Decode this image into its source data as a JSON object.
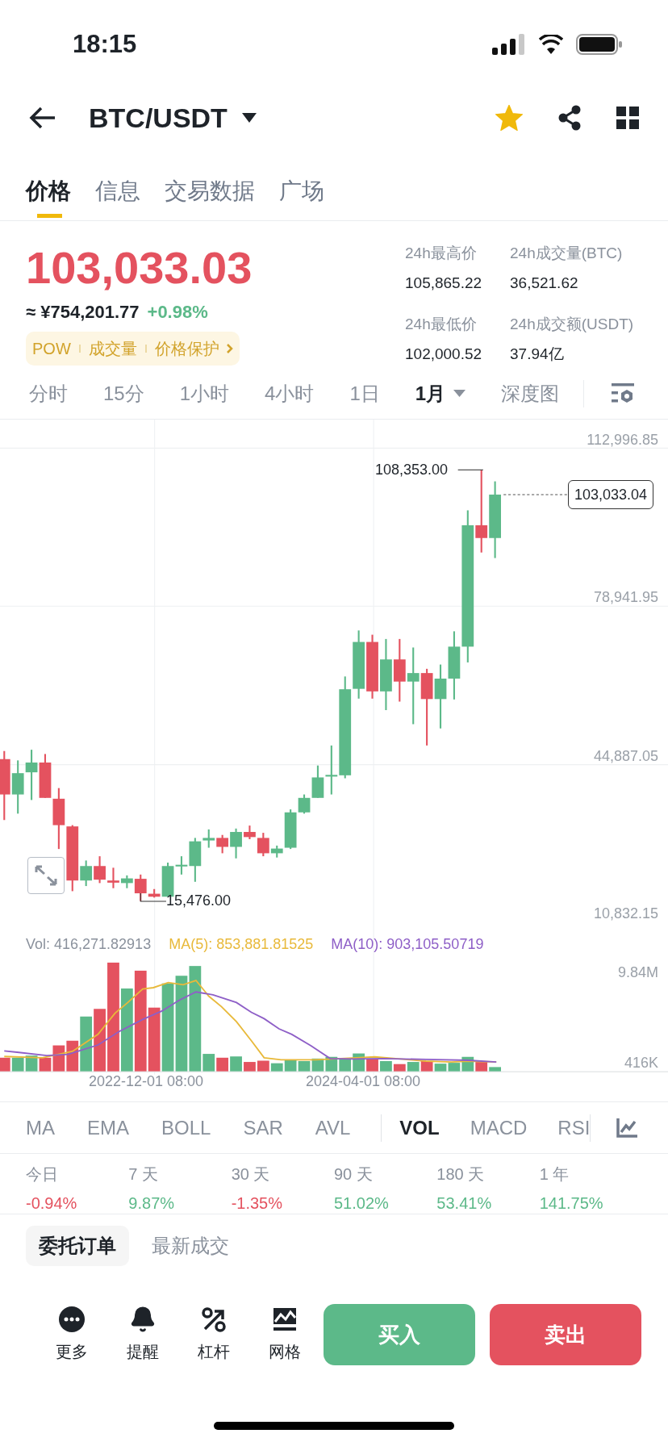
{
  "status_bar": {
    "time": "18:15"
  },
  "header": {
    "pair": "BTC/USDT",
    "favorite": true
  },
  "tabs": [
    {
      "label": "价格",
      "selected": true
    },
    {
      "label": "信息",
      "selected": false
    },
    {
      "label": "交易数据",
      "selected": false
    },
    {
      "label": "广场",
      "selected": false
    }
  ],
  "ticker": {
    "last_price": "103,033.03",
    "fiat_price": "≈ ¥754,201.77",
    "change": {
      "text": "+0.98%",
      "color": "#5cb989"
    },
    "tags": [
      "POW",
      "成交量",
      "价格保护"
    ]
  },
  "stats": [
    {
      "label": "24h最高价",
      "value": "105,865.22"
    },
    {
      "label": "24h成交量(BTC)",
      "value": "36,521.62"
    },
    {
      "label": "24h最低价",
      "value": "102,000.52"
    },
    {
      "label": "24h成交额(USDT)",
      "value": "37.94亿"
    }
  ],
  "intervals": [
    {
      "label": "分时",
      "selected": false,
      "dropdown": false
    },
    {
      "label": "15分",
      "selected": false,
      "dropdown": false
    },
    {
      "label": "1小时",
      "selected": false,
      "dropdown": false
    },
    {
      "label": "4小时",
      "selected": false,
      "dropdown": false
    },
    {
      "label": "1日",
      "selected": false,
      "dropdown": false
    },
    {
      "label": "1月",
      "selected": true,
      "dropdown": true
    },
    {
      "label": "深度图",
      "selected": false,
      "dropdown": false
    }
  ],
  "chart": {
    "price_axis": [
      "112,996.85",
      "78,941.95",
      "44,887.05",
      "10,832.15"
    ],
    "high_marker": "108,353.00",
    "low_marker": "15,476.00",
    "last_price_tag": "103,033.04"
  },
  "volume": {
    "vol": "Vol: 416,271.82913",
    "ma5": "MA(5): 853,881.81525",
    "ma10": "MA(10): 903,105.50719",
    "axis": [
      "9.84M",
      "416K"
    ],
    "dates": [
      "2022-12-01 08:00",
      "2024-04-01 08:00"
    ]
  },
  "indicators": [
    {
      "label": "MA",
      "kind": "main",
      "selected": false
    },
    {
      "label": "EMA",
      "kind": "main",
      "selected": false
    },
    {
      "label": "BOLL",
      "kind": "main",
      "selected": false
    },
    {
      "label": "SAR",
      "kind": "main",
      "selected": false
    },
    {
      "label": "AVL",
      "kind": "main",
      "selected": false
    },
    {
      "label": "VOL",
      "kind": "sub",
      "selected": true
    },
    {
      "label": "MACD",
      "kind": "sub",
      "selected": false
    },
    {
      "label": "RSI",
      "kind": "sub",
      "selected": false
    }
  ],
  "performance": [
    {
      "period": "今日",
      "change": "-0.94%",
      "color": "#e4525f"
    },
    {
      "period": "7 天",
      "change": "9.87%",
      "color": "#5cb989"
    },
    {
      "period": "30 天",
      "change": "-1.35%",
      "color": "#e4525f"
    },
    {
      "period": "90 天",
      "change": "51.02%",
      "color": "#5cb989"
    },
    {
      "period": "180 天",
      "change": "53.41%",
      "color": "#5cb989"
    },
    {
      "period": "1 年",
      "change": "141.75%",
      "color": "#5cb989"
    }
  ],
  "order_tabs": [
    {
      "label": "委托订单",
      "selected": true
    },
    {
      "label": "最新成交",
      "selected": false
    }
  ],
  "actions": [
    {
      "label": "更多",
      "kind": "more"
    },
    {
      "label": "提醒",
      "kind": "alert"
    },
    {
      "label": "杠杆",
      "kind": "margin"
    },
    {
      "label": "网格",
      "kind": "grid"
    }
  ],
  "buy": "买入",
  "sell": "卖出"
}
